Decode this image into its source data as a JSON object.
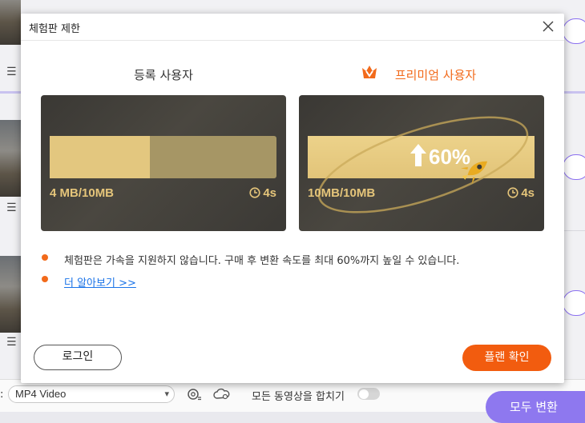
{
  "dialog": {
    "title": "체험판 제한",
    "registered": {
      "heading": "등록 사용자",
      "size": "4 MB/10MB",
      "time": "4s",
      "progress": 0.44
    },
    "premium": {
      "heading": "프리미엄 사용자",
      "size": "10MB/10MB",
      "time": "4s",
      "speed_boost": "60%",
      "progress": 1.0
    },
    "note": "체험판은 가속을 지원하지 않습니다. 구매 후 변환 속도를 최대 60%까지 높일 수 있습니다.",
    "learn_more": "더 알아보기 >>",
    "login_label": "로그인",
    "plan_label": "플랜 확인"
  },
  "background": {
    "output_format": "MP4 Video",
    "merge_label": "모든 동영상을 합치기",
    "merge_enabled": false,
    "convert_all_label": "모두 변환"
  },
  "colors": {
    "accent_orange": "#f25c0f",
    "gold": "#e5c57a",
    "purple": "#8e78ef"
  },
  "icons": [
    "close-icon",
    "crown-icon",
    "clock-icon",
    "arrow-up-icon",
    "rocket-icon",
    "settings-icon",
    "gear-icon",
    "cloud-icon",
    "chevron-down-icon"
  ]
}
